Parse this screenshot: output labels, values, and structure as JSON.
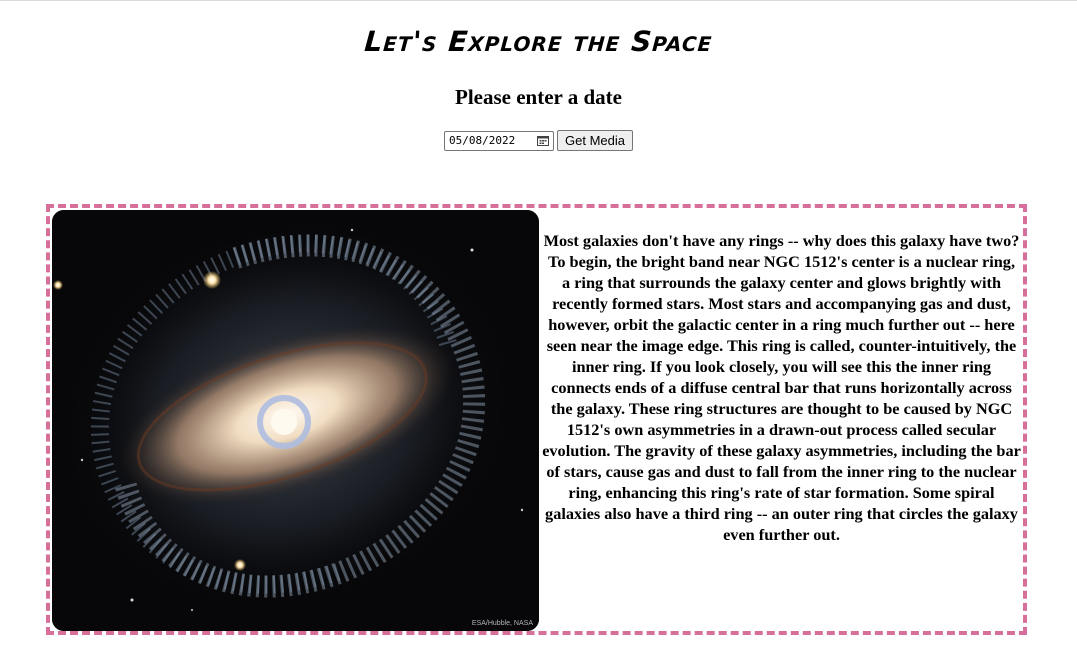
{
  "header": {
    "title": "Let's Explore the Space",
    "subtitle": "Please enter a date"
  },
  "form": {
    "date_value": "05/08/2022",
    "button_label": "Get Media"
  },
  "media": {
    "image_credit": "ESA/Hubble, NASA",
    "explanation": "Most galaxies don't have any rings -- why does this galaxy have two? To begin, the bright band near NGC 1512's center is a nuclear ring, a ring that surrounds the galaxy center and glows brightly with recently formed stars. Most stars and accompanying gas and dust, however, orbit the galactic center in a ring much further out -- here seen near the image edge. This ring is called, counter-intuitively, the inner ring. If you look closely, you will see this the inner ring connects ends of a diffuse central bar that runs horizontally across the galaxy. These ring structures are thought to be caused by NGC 1512's own asymmetries in a drawn-out process called secular evolution. The gravity of these galaxy asymmetries, including the bar of stars, cause gas and dust to fall from the inner ring to the nuclear ring, enhancing this ring's rate of star formation. Some spiral galaxies also have a third ring -- an outer ring that circles the galaxy even further out."
  },
  "colors": {
    "card_border": "#d6709a",
    "image_background": "#070709"
  }
}
